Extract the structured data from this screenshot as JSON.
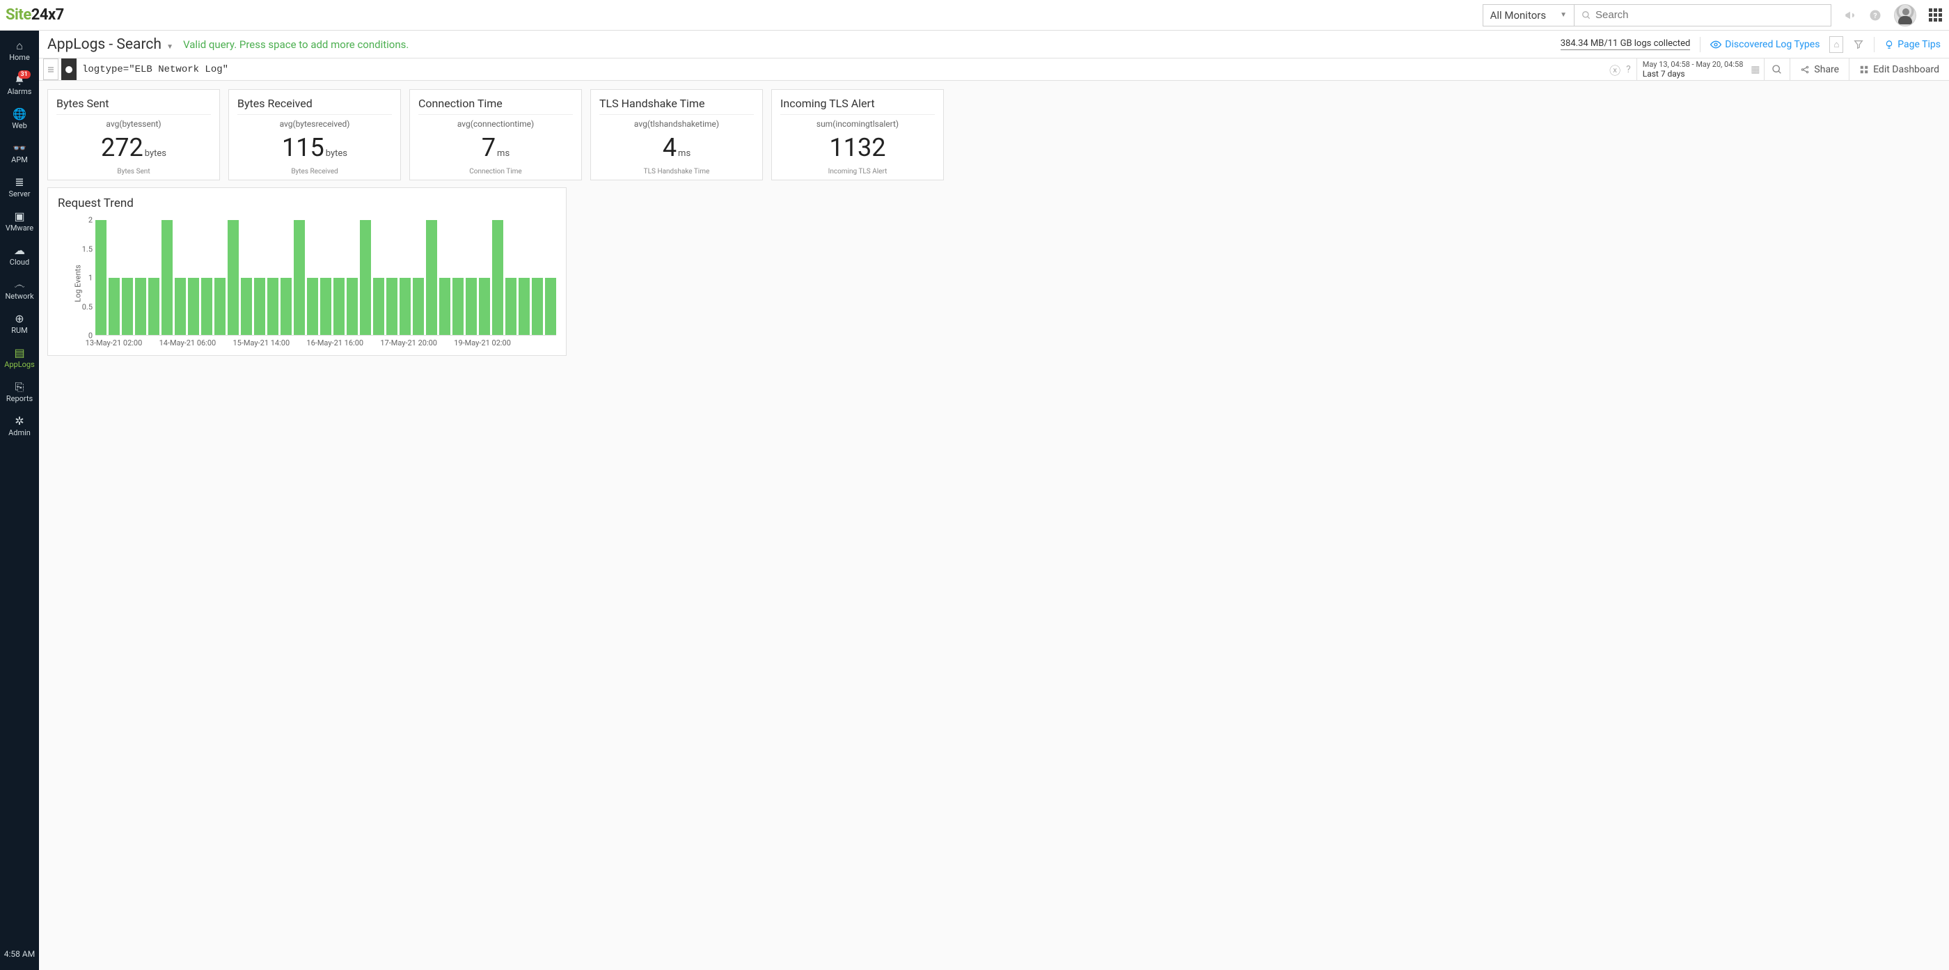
{
  "brand": {
    "green": "Site",
    "dark": "24x7"
  },
  "topbar": {
    "monitor_selector": "All Monitors",
    "search_placeholder": "Search"
  },
  "sidebar": {
    "items": [
      {
        "id": "home",
        "label": "Home"
      },
      {
        "id": "alarms",
        "label": "Alarms",
        "badge": "31"
      },
      {
        "id": "web",
        "label": "Web"
      },
      {
        "id": "apm",
        "label": "APM"
      },
      {
        "id": "server",
        "label": "Server"
      },
      {
        "id": "vmware",
        "label": "VMware"
      },
      {
        "id": "cloud",
        "label": "Cloud"
      },
      {
        "id": "network",
        "label": "Network"
      },
      {
        "id": "rum",
        "label": "RUM"
      },
      {
        "id": "applogs",
        "label": "AppLogs",
        "active": true
      },
      {
        "id": "reports",
        "label": "Reports"
      },
      {
        "id": "admin",
        "label": "Admin"
      }
    ],
    "time": "4:58 AM"
  },
  "page": {
    "title": "AppLogs - Search",
    "valid_msg": "Valid query. Press space to add more conditions.",
    "logs_collected": "384.34 MB/11 GB logs collected",
    "discovered_link": "Discovered Log Types",
    "page_tips": "Page Tips"
  },
  "querybar": {
    "query": "logtype=\"ELB Network Log\"",
    "date_line1": "May 13, 04:58 - May 20, 04:58",
    "date_line2": "Last 7 days",
    "share": "Share",
    "edit_dash": "Edit Dashboard"
  },
  "cards": [
    {
      "title": "Bytes Sent",
      "sub": "avg(bytessent)",
      "value": "272",
      "unit": "bytes",
      "foot": "Bytes Sent"
    },
    {
      "title": "Bytes Received",
      "sub": "avg(bytesreceived)",
      "value": "115",
      "unit": "bytes",
      "foot": "Bytes Received"
    },
    {
      "title": "Connection Time",
      "sub": "avg(connectiontime)",
      "value": "7",
      "unit": "ms",
      "foot": "Connection Time"
    },
    {
      "title": "TLS Handshake Time",
      "sub": "avg(tlshandshaketime)",
      "value": "4",
      "unit": "ms",
      "foot": "TLS Handshake Time"
    },
    {
      "title": "Incoming TLS Alert",
      "sub": "sum(incomingtlsalert)",
      "value": "1132",
      "unit": "",
      "foot": "Incoming TLS Alert"
    }
  ],
  "chart_data": {
    "type": "bar",
    "title": "Request Trend",
    "ylabel": "Log Events",
    "ylim": [
      0,
      2
    ],
    "yticks": [
      0,
      0.5,
      1,
      1.5,
      2
    ],
    "values": [
      2,
      1,
      1,
      1,
      1,
      2,
      1,
      1,
      1,
      1,
      2,
      1,
      1,
      1,
      1,
      2,
      1,
      1,
      1,
      1,
      2,
      1,
      1,
      1,
      1,
      2,
      1,
      1,
      1,
      1,
      2,
      1,
      1,
      1,
      1
    ],
    "xticks": [
      {
        "pos": 0.04,
        "label": "13-May-21 02:00"
      },
      {
        "pos": 0.2,
        "label": "14-May-21 06:00"
      },
      {
        "pos": 0.36,
        "label": "15-May-21 14:00"
      },
      {
        "pos": 0.52,
        "label": "16-May-21 16:00"
      },
      {
        "pos": 0.68,
        "label": "17-May-21 20:00"
      },
      {
        "pos": 0.84,
        "label": "19-May-21 02:00"
      }
    ]
  }
}
